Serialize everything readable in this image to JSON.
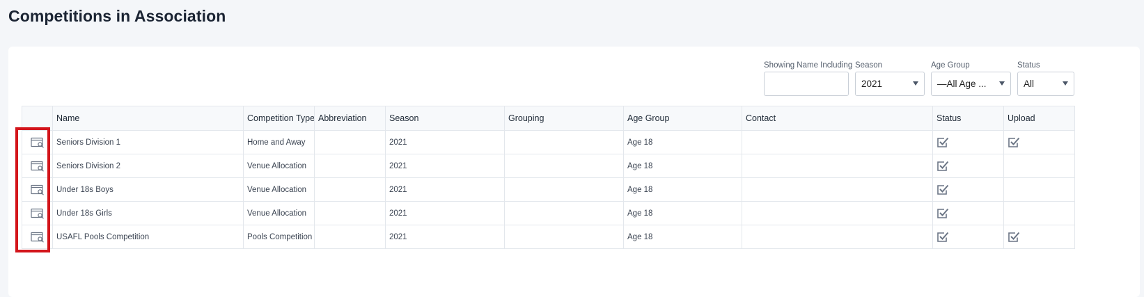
{
  "page": {
    "title": "Competitions in Association"
  },
  "filters": {
    "name_search": {
      "label": "Showing Name Including",
      "value": ""
    },
    "season": {
      "label": "Season",
      "value": "2021"
    },
    "age_group": {
      "label": "Age Group",
      "value": "—All Age ..."
    },
    "status": {
      "label": "Status",
      "value": "All"
    }
  },
  "table": {
    "columns": [
      "",
      "Name",
      "Competition Type",
      "Abbreviation",
      "Season",
      "Grouping",
      "Age Group",
      "Contact",
      "Status",
      "Upload"
    ],
    "rows": [
      {
        "name": "Seniors Division 1",
        "type": "Home and Away",
        "abbreviation": "",
        "season": "2021",
        "grouping": "",
        "age_group": "Age 18",
        "contact": "",
        "status_checked": true,
        "upload_checked": true
      },
      {
        "name": "Seniors Division 2",
        "type": "Venue Allocation",
        "abbreviation": "",
        "season": "2021",
        "grouping": "",
        "age_group": "Age 18",
        "contact": "",
        "status_checked": true,
        "upload_checked": false
      },
      {
        "name": "Under 18s Boys",
        "type": "Venue Allocation",
        "abbreviation": "",
        "season": "2021",
        "grouping": "",
        "age_group": "Age 18",
        "contact": "",
        "status_checked": true,
        "upload_checked": false
      },
      {
        "name": "Under 18s Girls",
        "type": "Venue Allocation",
        "abbreviation": "",
        "season": "2021",
        "grouping": "",
        "age_group": "Age 18",
        "contact": "",
        "status_checked": true,
        "upload_checked": false
      },
      {
        "name": "USAFL Pools Competition",
        "type": "Pools Competition",
        "abbreviation": "",
        "season": "2021",
        "grouping": "",
        "age_group": "Age 18",
        "contact": "",
        "status_checked": true,
        "upload_checked": true
      }
    ]
  },
  "icons": {
    "view": "view-details-icon",
    "check": "checkbox-checked-icon"
  },
  "colors": {
    "highlight": "#d3151b",
    "icon": "#6b7585",
    "background": "#f4f6f9"
  }
}
